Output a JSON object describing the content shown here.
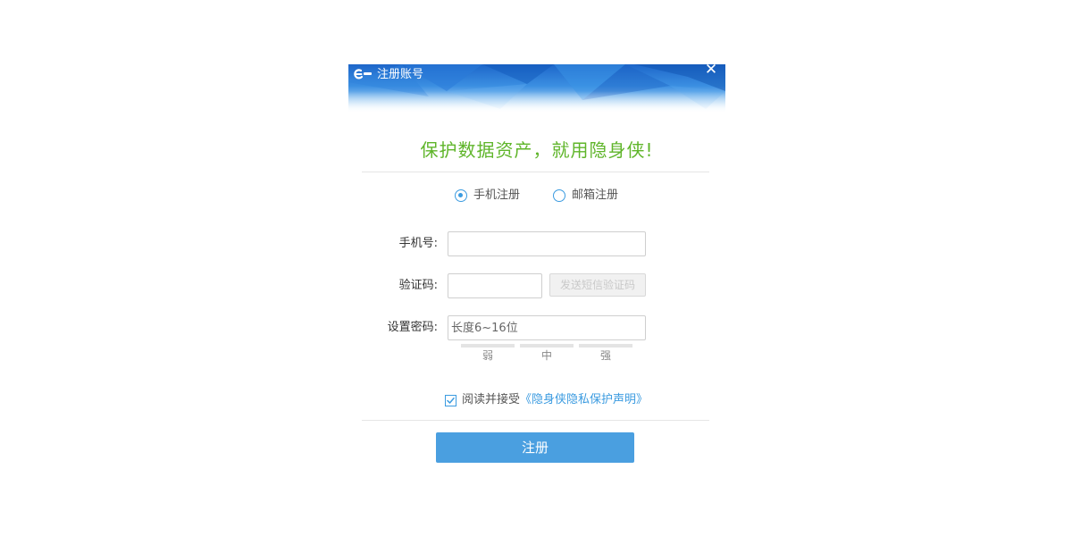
{
  "window": {
    "title": "注册账号",
    "close_symbol": "✕"
  },
  "slogan": "保护数据资产，就用隐身侠!",
  "register_type": {
    "options": [
      {
        "label": "手机注册",
        "selected": true
      },
      {
        "label": "邮箱注册",
        "selected": false
      }
    ]
  },
  "form": {
    "phone_label": "手机号:",
    "phone_value": "",
    "code_label": "验证码:",
    "code_value": "",
    "sms_button_label": "发送短信验证码",
    "password_label": "设置密码:",
    "password_placeholder": "长度6~16位"
  },
  "password_strength": {
    "levels": [
      "弱",
      "中",
      "强"
    ]
  },
  "agreement": {
    "checked": true,
    "text": "阅读并接受",
    "link_text": "《隐身侠隐私保护声明》"
  },
  "register_button_label": "注册",
  "colors": {
    "accent": "#4a9fe0",
    "slogan": "#5fb52a",
    "banner": "#1f6fd0"
  }
}
